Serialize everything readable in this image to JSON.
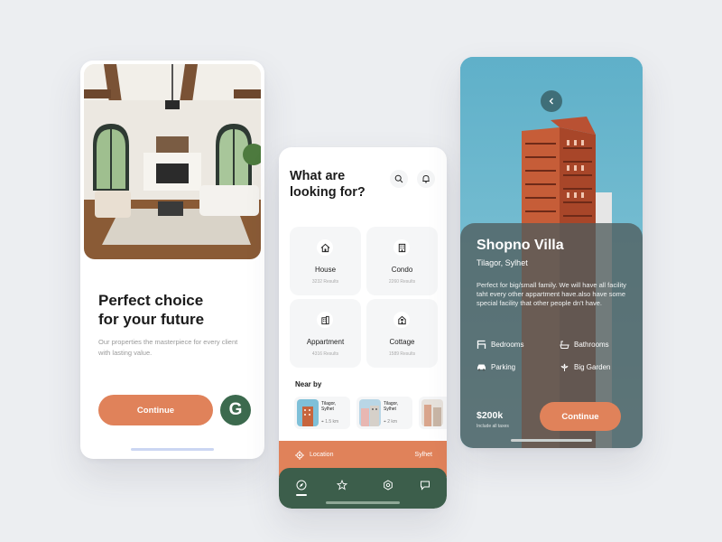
{
  "onboarding": {
    "title_line1": "Perfect choice",
    "title_line2": "for your future",
    "subtitle": "Our properties the masterpiece for every client with lasting value.",
    "continue_label": "Continue",
    "google_label": "G"
  },
  "search": {
    "title_line1": "What are",
    "title_line2": "looking for?",
    "categories": [
      {
        "name": "House",
        "count": "3232 Results",
        "icon": "house-icon"
      },
      {
        "name": "Condo",
        "count": "2260 Results",
        "icon": "building-icon"
      },
      {
        "name": "Appartment",
        "count": "4316 Results",
        "icon": "apartment-icon"
      },
      {
        "name": "Cottage",
        "count": "1589 Results",
        "icon": "cottage-icon"
      }
    ],
    "near_by_label": "Near by",
    "near_by": [
      {
        "name": "Tilagor, Sylhet",
        "distance": "1.5 km"
      },
      {
        "name": "Tilagor, Sylhet",
        "distance": "2 km"
      }
    ],
    "location_label": "Location",
    "location_value": "Sylhet",
    "tabs": [
      "compass-icon",
      "star-icon",
      "settings-icon",
      "chat-icon"
    ]
  },
  "details": {
    "title": "Shopno Villa",
    "location": "Tilagor, Sylhet",
    "description": "Perfect for  big/small family. We will have all facility taht every other appartment have.also have some special facility that other people dn't have.",
    "amenities": [
      {
        "label": "Bedrooms",
        "icon": "bed-icon"
      },
      {
        "label": "Bathrooms",
        "icon": "bathtub-icon"
      },
      {
        "label": "Parking",
        "icon": "car-icon"
      },
      {
        "label": "Big Garden",
        "icon": "flower-icon"
      }
    ],
    "price": "$200k",
    "price_note": "Include all taxes",
    "continue_label": "Continue"
  },
  "colors": {
    "accent": "#e0825a",
    "green": "#3c6a4e",
    "sky": "#6eb3c8",
    "background": "#eceef1"
  }
}
